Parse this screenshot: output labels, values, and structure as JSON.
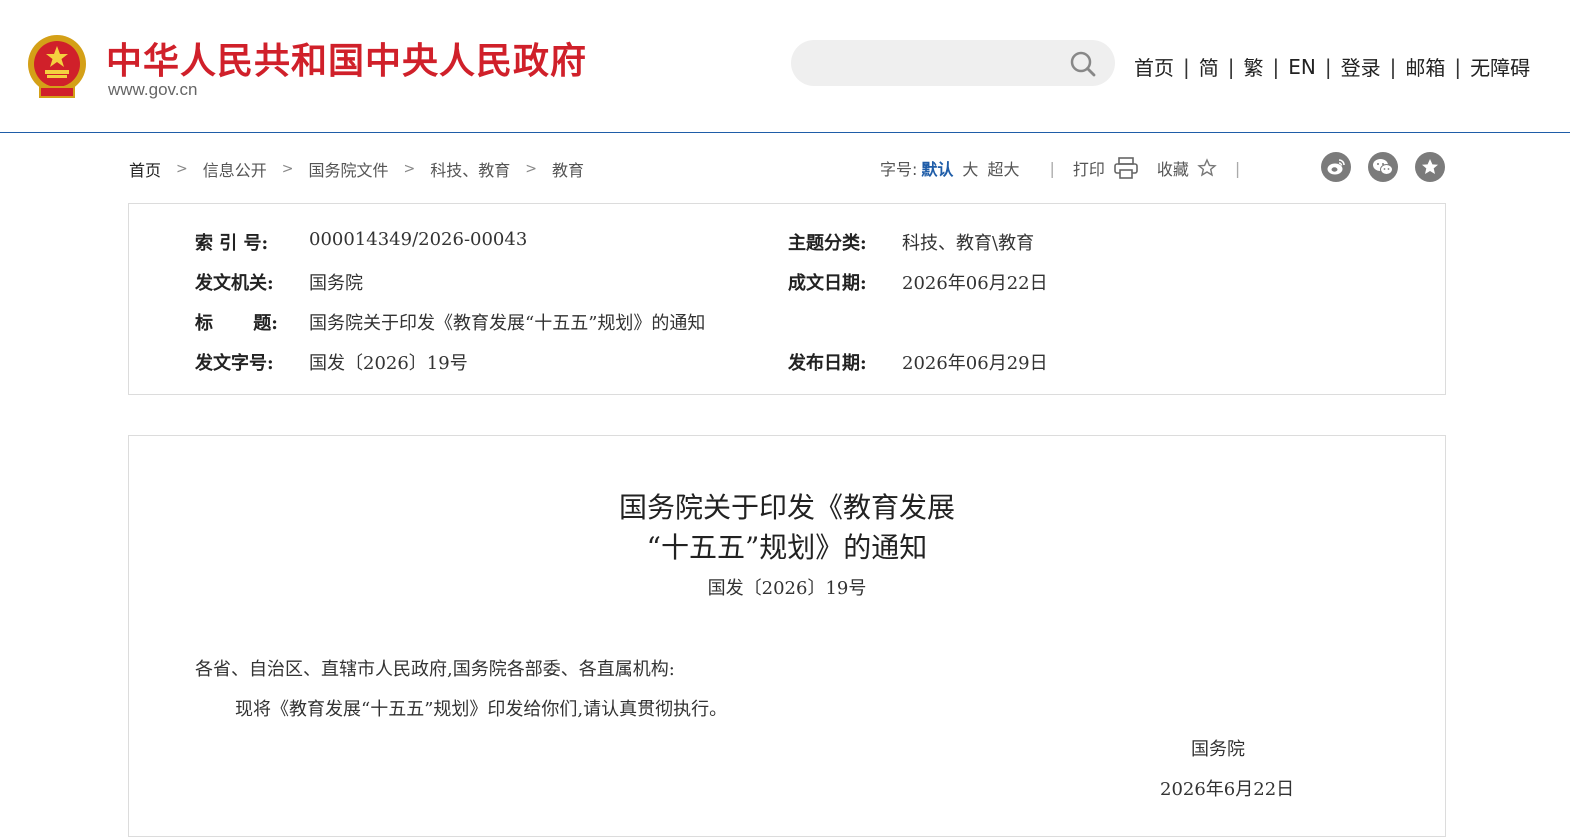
{
  "header": {
    "site_name": "中华人民共和国中央人民政府",
    "site_url": "www.gov.cn",
    "search_placeholder": "",
    "nav": [
      {
        "label": "首页"
      },
      {
        "label": "简"
      },
      {
        "label": "繁"
      },
      {
        "label": "EN"
      },
      {
        "label": "登录"
      },
      {
        "label": "邮箱"
      },
      {
        "label": "无障碍"
      }
    ],
    "nav_separator": "|"
  },
  "breadcrumb": {
    "items": [
      "首页",
      "信息公开",
      "国务院文件",
      "科技、教育",
      "教育"
    ],
    "arrow": ">"
  },
  "toolbar": {
    "font_size_label": "字号:",
    "font_default": "默认",
    "font_large": "大",
    "font_xlarge": "超大",
    "separator": "|",
    "print_label": "打印",
    "favorite_label": "收藏"
  },
  "colors": {
    "brand_red": "#d0202a",
    "link_blue": "#1f5da8",
    "share_gray": "#7b7b7b"
  },
  "meta": {
    "index_label": "索 引 号:",
    "index_value": "000014349/2026-00043",
    "topic_label": "主题分类:",
    "topic_value": "科技、教育\\教育",
    "issuer_label": "发文机关:",
    "issuer_value": "国务院",
    "written_date_label": "成文日期:",
    "written_date_value": "2026年06月22日",
    "title_label": "标 题:",
    "title_value": "国务院关于印发《教育发展“十五五”规划》的通知",
    "docno_label": "发文字号:",
    "docno_value": "国发〔2026〕19号",
    "publish_date_label": "发布日期:",
    "publish_date_value": "2026年06月29日"
  },
  "article": {
    "title_line1": "国务院关于印发《教育发展",
    "title_line2": "“十五五”规划》的通知",
    "doc_number": "国发〔2026〕19号",
    "salutation": "各省、自治区、直辖市人民政府,国务院各部委、各直属机构:",
    "body": "现将《教育发展“十五五”规划》印发给你们,请认真贯彻执行。",
    "signature": "国务院",
    "date": "2026年6月22日"
  }
}
